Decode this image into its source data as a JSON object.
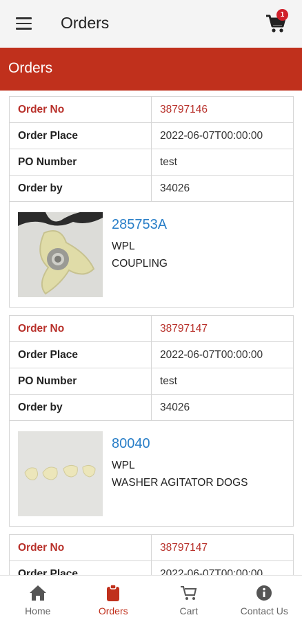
{
  "appbar": {
    "title": "Orders",
    "cart_badge": "1"
  },
  "section": {
    "title": "Orders"
  },
  "labels": {
    "order_no": "Order No",
    "order_place": "Order Place",
    "po_number": "PO Number",
    "order_by": "Order by"
  },
  "orders": [
    {
      "order_no": "38797146",
      "order_place": "2022-06-07T00:00:00",
      "po_number": "test",
      "order_by": "34026",
      "product": {
        "number": "285753A",
        "brand": "WPL",
        "description": "COUPLING"
      }
    },
    {
      "order_no": "38797147",
      "order_place": "2022-06-07T00:00:00",
      "po_number": "test",
      "order_by": "34026",
      "product": {
        "number": "80040",
        "brand": "WPL",
        "description": "WASHER AGITATOR DOGS"
      }
    },
    {
      "order_no": "38797147",
      "order_place": "2022-06-07T00:00:00"
    }
  ],
  "bottom_nav": [
    {
      "label": "Home",
      "icon": "home-icon"
    },
    {
      "label": "Orders",
      "icon": "clipboard-icon",
      "active": true
    },
    {
      "label": "Cart",
      "icon": "cart-icon"
    },
    {
      "label": "Contact Us",
      "icon": "info-icon"
    }
  ],
  "colors": {
    "accent": "#c0301c",
    "link": "#2a7fc8",
    "badge": "#d0212b"
  }
}
